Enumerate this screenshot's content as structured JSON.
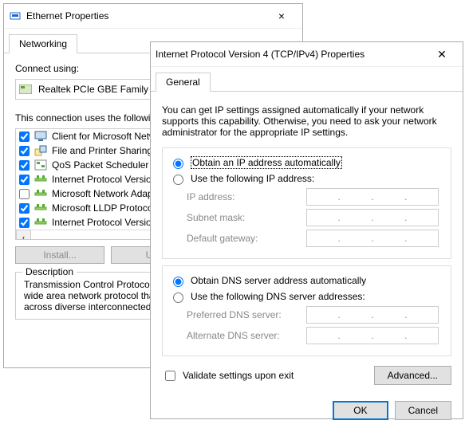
{
  "parent": {
    "title": "Ethernet Properties",
    "tab": "Networking",
    "connect_label": "Connect using:",
    "adapter": "Realtek PCIe GBE Family C",
    "uses_label": "This connection uses the following",
    "items": [
      {
        "checked": true,
        "icon": "client",
        "label": "Client for Microsoft Network"
      },
      {
        "checked": true,
        "icon": "share",
        "label": "File and Printer Sharing fo"
      },
      {
        "checked": true,
        "icon": "sched",
        "label": "QoS Packet Scheduler"
      },
      {
        "checked": true,
        "icon": "proto",
        "label": "Internet Protocol Version"
      },
      {
        "checked": false,
        "icon": "proto",
        "label": "Microsoft Network Adapte"
      },
      {
        "checked": true,
        "icon": "proto",
        "label": "Microsoft LLDP Protocol"
      },
      {
        "checked": true,
        "icon": "proto",
        "label": "Internet Protocol Version"
      }
    ],
    "btn_install": "Install...",
    "btn_uninstall": "Unin",
    "desc_title": "Description",
    "desc_text": "Transmission Control Protocol/I\nwide area network protocol that\nacross diverse interconnected n"
  },
  "dialog": {
    "title": "Internet Protocol Version 4 (TCP/IPv4) Properties",
    "tab": "General",
    "intro": "You can get IP settings assigned automatically if your network supports this capability. Otherwise, you need to ask your network administrator for the appropriate IP settings.",
    "ip_auto": "Obtain an IP address automatically",
    "ip_manual": "Use the following IP address:",
    "fields_ip": {
      "ip": "IP address:",
      "mask": "Subnet mask:",
      "gw": "Default gateway:"
    },
    "dns_auto": "Obtain DNS server address automatically",
    "dns_manual": "Use the following DNS server addresses:",
    "fields_dns": {
      "pref": "Preferred DNS server:",
      "alt": "Alternate DNS server:"
    },
    "validate": "Validate settings upon exit",
    "advanced": "Advanced...",
    "ok": "OK",
    "cancel": "Cancel"
  }
}
